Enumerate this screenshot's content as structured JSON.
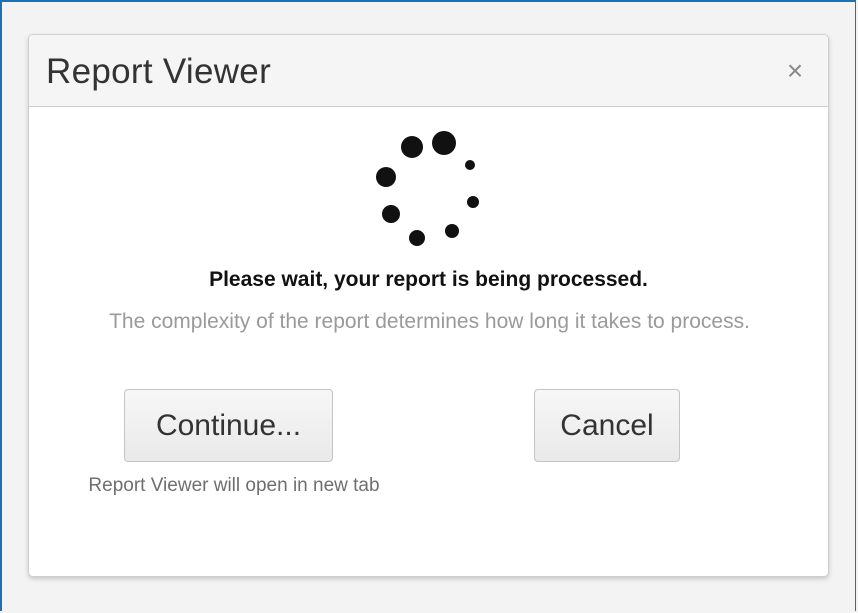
{
  "dialog": {
    "title": "Report Viewer",
    "close_symbol": "×",
    "spinner_icon": "loading-spinner-icon",
    "wait_message": "Please wait, your report is being processed.",
    "complexity_message": "The complexity of the report determines how long it takes to process.",
    "continue_label": "Continue...",
    "cancel_label": "Cancel",
    "continue_note": "Report Viewer will open in new tab"
  },
  "colors": {
    "window_border": "#1f6fb5",
    "header_background": "#f5f5f5",
    "button_background": "#eeeeee",
    "muted_text": "#9a9a9a"
  }
}
